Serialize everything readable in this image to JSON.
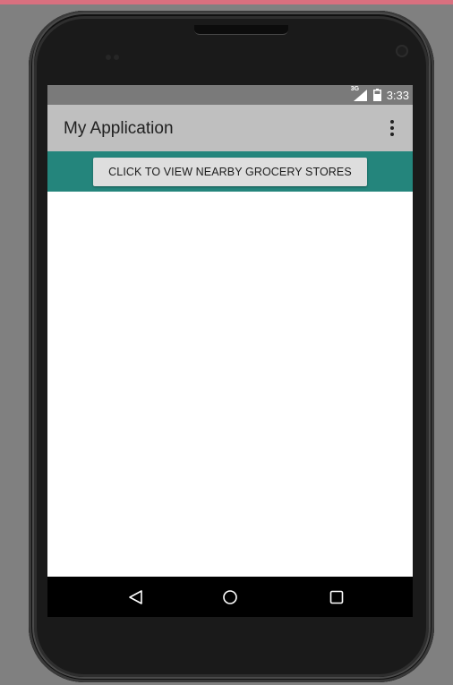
{
  "app": {
    "title": "My Application"
  },
  "status_bar": {
    "network_label": "3G",
    "time": "3:33"
  },
  "toolbar": {
    "overflow_icon": "more-vert-icon"
  },
  "main": {
    "button_label": "CLICK TO VIEW NEARBY GROCERY STORES"
  },
  "nav_bar": {
    "back_icon": "back-icon",
    "home_icon": "home-icon",
    "recents_icon": "recents-icon"
  },
  "colors": {
    "background": "#808080",
    "status_bar": "#7a7a7a",
    "app_bar": "#bfbfbf",
    "accent_band": "#24857c",
    "button": "#dedede",
    "nav_bar": "#000000"
  }
}
